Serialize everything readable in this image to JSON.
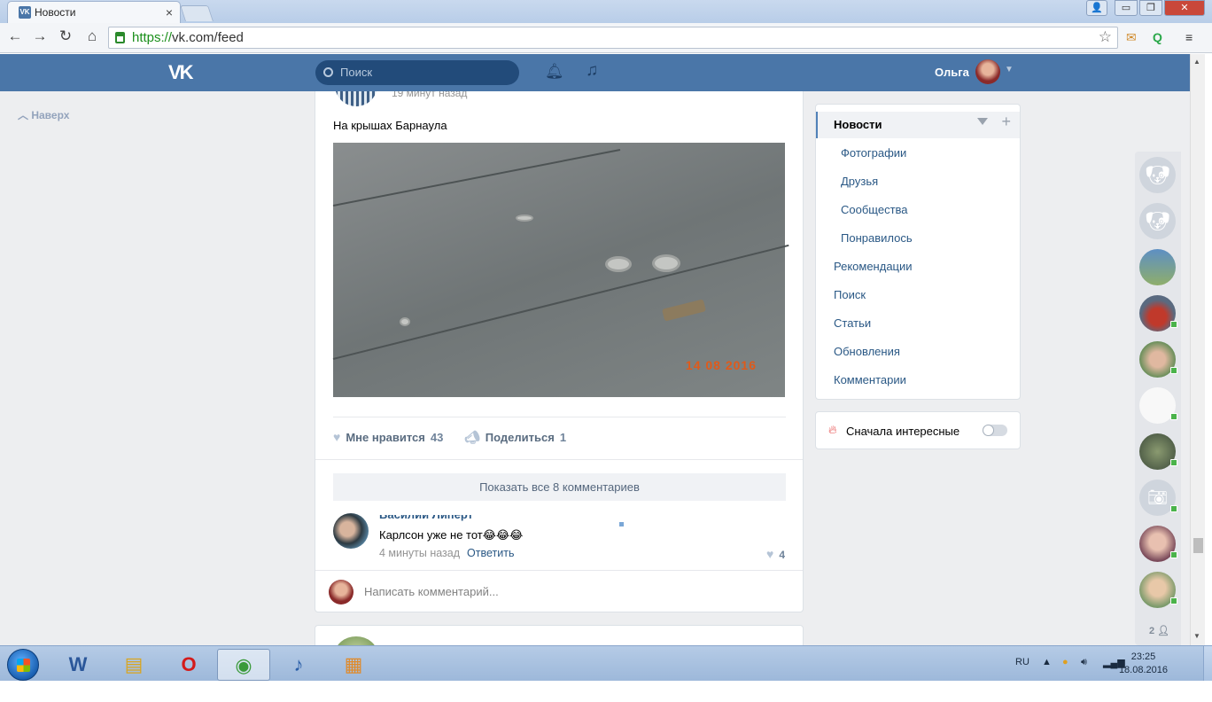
{
  "browser": {
    "tab_title": "Новости",
    "tab_close": "×",
    "url_https": "https://",
    "url_rest": "vk.com/feed",
    "win_min": "▭",
    "win_max": "❐",
    "win_close": "✕"
  },
  "vk": {
    "search_placeholder": "Поиск",
    "user_name": "Ольга",
    "back_to_top": "Наверх"
  },
  "post": {
    "time": "19 минут назад",
    "text": "На крышах Барнаула",
    "photo_stamp": "14 08 2016",
    "like_label": "Мне нравится",
    "like_count": "43",
    "share_label": "Поделиться",
    "share_count": "1",
    "show_all_comments": "Показать все 8 комментариев"
  },
  "comment": {
    "author": "Василий Липерт",
    "text": "Карлсон уже не тот😂😂😂",
    "time": "4 минуты назад",
    "reply": "Ответить",
    "likes": "4"
  },
  "write_comment_placeholder": "Написать комментарий...",
  "menu": {
    "items": [
      {
        "label": "Новости"
      },
      {
        "label": "Фотографии"
      },
      {
        "label": "Друзья"
      },
      {
        "label": "Сообщества"
      },
      {
        "label": "Понравилось"
      },
      {
        "label": "Рекомендации"
      },
      {
        "label": "Поиск"
      },
      {
        "label": "Статьи"
      },
      {
        "label": "Обновления"
      },
      {
        "label": "Комментарии"
      }
    ]
  },
  "interesting_first": {
    "label": "Сначала интересные",
    "enabled": false
  },
  "friends_online_count": "2",
  "taskbar": {
    "lang": "RU",
    "time": "23:25",
    "date": "18.08.2016"
  },
  "colors": {
    "vk_blue": "#4a76a8",
    "link": "#2a5885",
    "page_bg": "#edeef0"
  }
}
